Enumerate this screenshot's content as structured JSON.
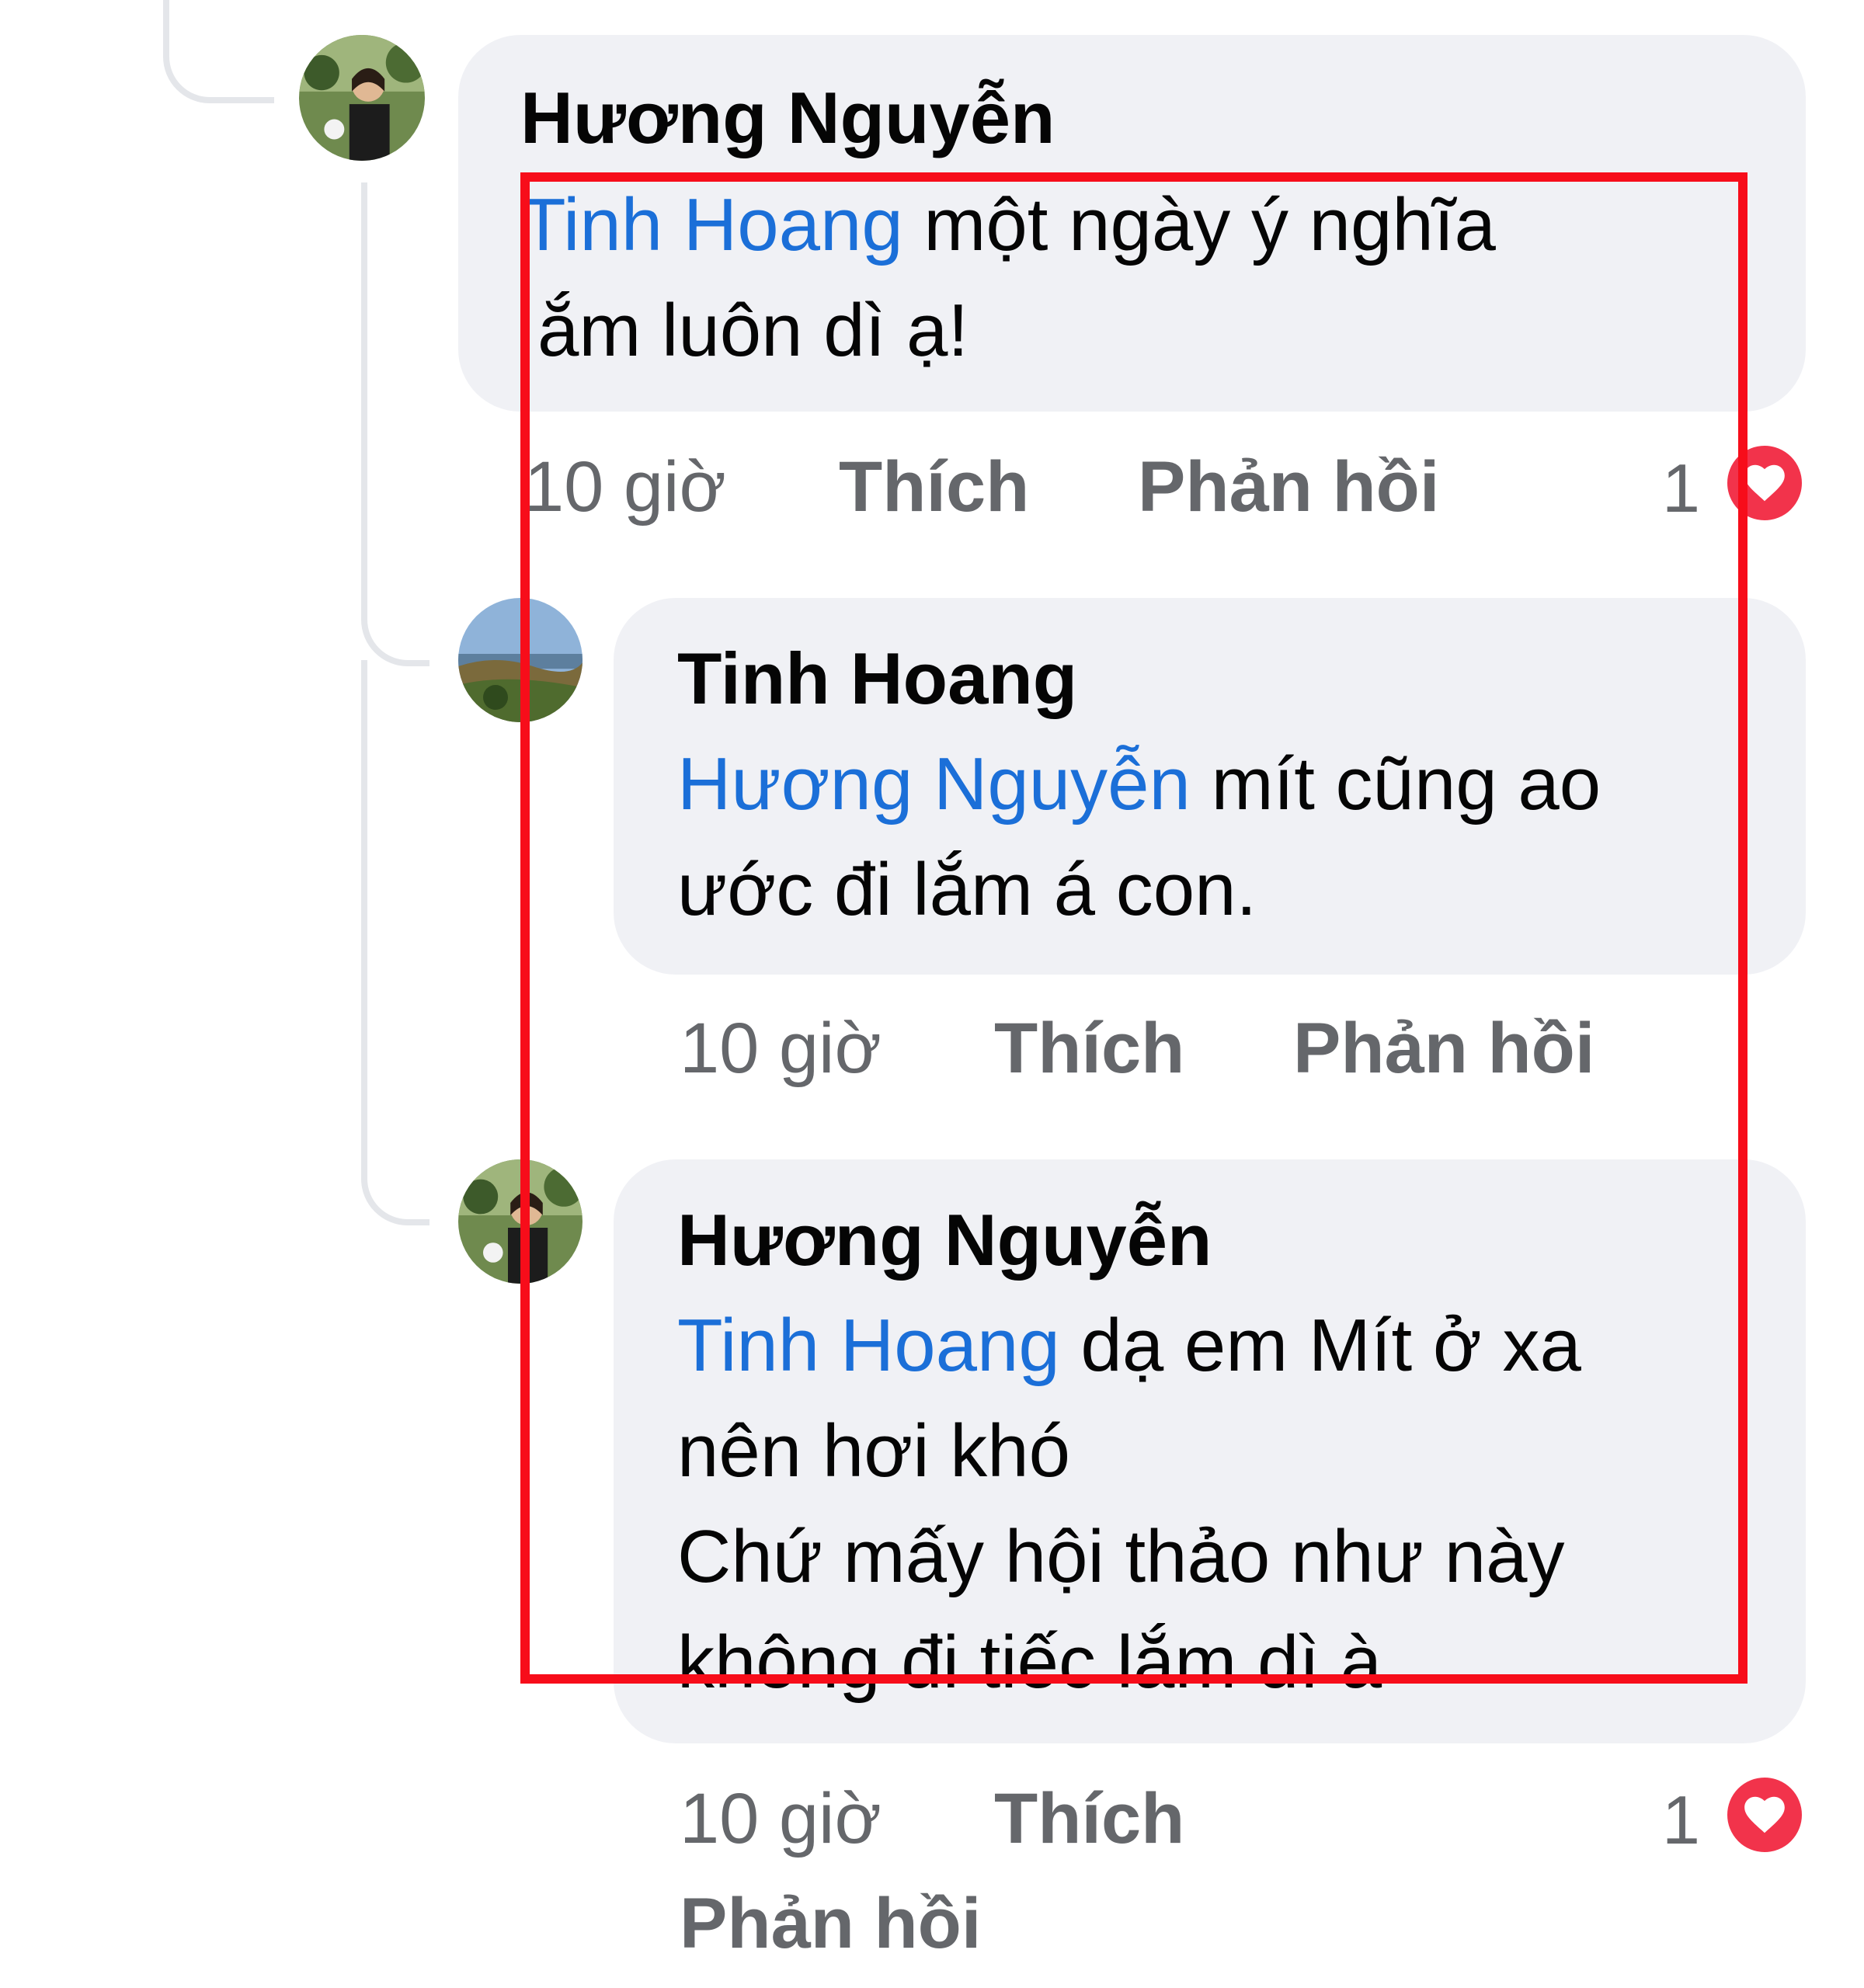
{
  "comments": [
    {
      "author": "Hương Nguyễn",
      "mention": "Tinh Hoang",
      "text_line1": " một ngày ý nghĩa",
      "text_line2": "ắm luôn dì ạ!",
      "time": "10 giờ",
      "like_label": "Thích",
      "reply_label": "Phản hồi",
      "reaction_count": "1",
      "reaction_icon": "heart-icon"
    },
    {
      "author": "Tinh Hoang",
      "mention": "Hương Nguyễn",
      "text_line1": " mít cũng ao",
      "text_line2": "ước đi lắm á con.",
      "time": "10 giờ",
      "like_label": "Thích",
      "reply_label": "Phản hồi"
    },
    {
      "author": "Hương Nguyễn",
      "mention": "Tinh Hoang",
      "text_line1": " dạ em Mít ở xa",
      "text_line2": "nên hơi khó",
      "text_line3": "Chứ mấy hội thảo như này",
      "text_line4": "không đi tiếc lắm dì à",
      "time": "10 giờ",
      "like_label": "Thích",
      "reply_label": "Phản hồi",
      "reaction_count": "1",
      "reaction_icon": "heart-icon"
    }
  ],
  "colors": {
    "mention": "#1b6fd8",
    "bubble": "#f0f1f5",
    "highlight": "#f70d1a",
    "heart": "#f2334b"
  }
}
